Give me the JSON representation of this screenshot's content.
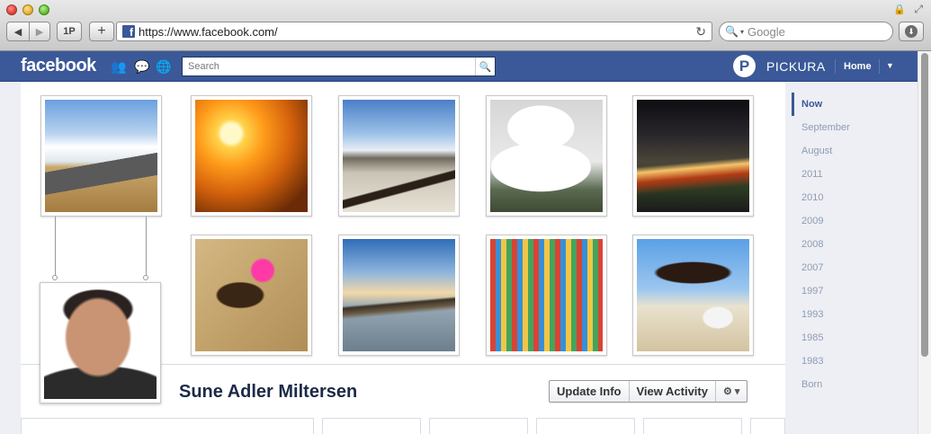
{
  "browser": {
    "url": "https://www.facebook.com/",
    "search_placeholder": "Google",
    "onepassword_label": "1P",
    "newtab_label": "+",
    "back_label": "◀",
    "forward_label": "▶"
  },
  "fb": {
    "logo": "facebook",
    "search_placeholder": "Search",
    "app_name": "PICKURA",
    "app_initial": "P",
    "home_label": "Home"
  },
  "profile": {
    "name": "Sune Adler Miltersen"
  },
  "actions": {
    "update_info": "Update Info",
    "view_activity": "View Activity"
  },
  "photos": [
    {
      "name": "photo-road",
      "class": "road"
    },
    {
      "name": "photo-sunset",
      "class": "sunset"
    },
    {
      "name": "photo-beach-driftwood",
      "class": "beach"
    },
    {
      "name": "photo-white-church",
      "class": "church"
    },
    {
      "name": "photo-city-night",
      "class": "city"
    },
    {
      "name": "photo-bullfight",
      "class": "bull"
    },
    {
      "name": "photo-boats",
      "class": "boats"
    },
    {
      "name": "photo-temple",
      "class": "temple"
    },
    {
      "name": "photo-surfer",
      "class": "surfer"
    }
  ],
  "timeline_nav": [
    "Now",
    "September",
    "August",
    "2011",
    "2010",
    "2009",
    "2008",
    "2007",
    "1997",
    "1993",
    "1985",
    "1983",
    "Born"
  ],
  "colors": {
    "fb_blue": "#3b5998",
    "nav_inactive": "#8f9bb5"
  }
}
